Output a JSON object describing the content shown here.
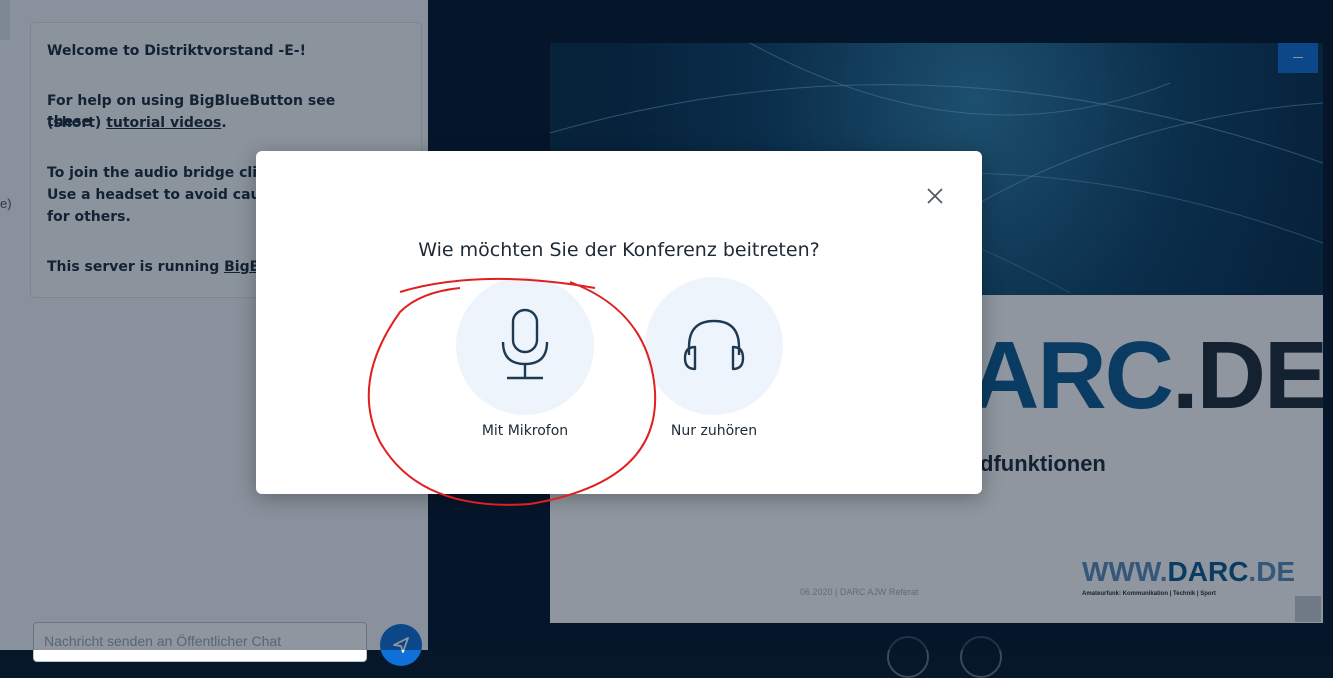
{
  "chat": {
    "welcome_title": "Welcome to Distriktvorstand  -E-!",
    "help_text": "For help on using BigBlueButton see these",
    "help_text_prefix": "(short) ",
    "tutorial_link": "tutorial videos",
    "help_text_suffix": ".",
    "audio_line1": "To join the audio bridge click",
    "audio_line2": "Use a headset to avoid causi",
    "audio_line3": "for others.",
    "server_prefix": "This server is running ",
    "server_link": "BigBlu",
    "left_cutoff_char": "e)",
    "input_placeholder": "Nachricht senden an Öffentlicher Chat",
    "send_icon": "send-icon"
  },
  "slide": {
    "brand_blue": "ARC",
    "brand_dark": ".DE",
    "subtitle": "dfunktionen",
    "footer": "06.2020 | DARC AJW Referat",
    "www_prefix": "WWW.",
    "www_bold": "DARC",
    "www_suffix": ".DE",
    "tagline": "Amateurfunk: Kommunikation | Technik | Sport"
  },
  "modal": {
    "title": "Wie möchten Sie der Konferenz beitreten?",
    "close_icon": "close-icon",
    "options": [
      {
        "label": "Mit Mikrofon",
        "icon": "microphone-icon"
      },
      {
        "label": "Nur zuhören",
        "icon": "headphones-icon"
      }
    ]
  },
  "colors": {
    "accent": "#0f70d7",
    "annotation": "#e02020",
    "overlay": "#06172a"
  }
}
